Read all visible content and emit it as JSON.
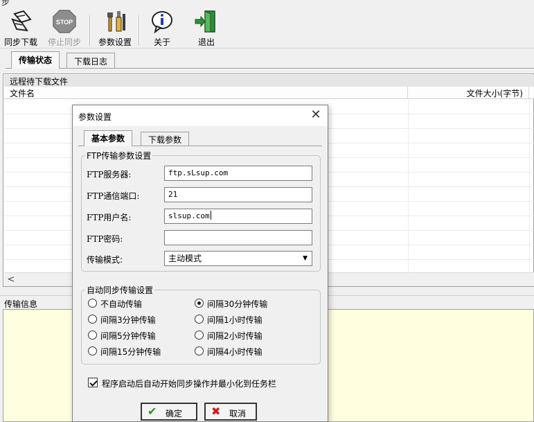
{
  "window": {
    "title_fragment": "步"
  },
  "toolbar": {
    "buttons": [
      {
        "label": "同步下载",
        "icon": "sync-download-icon",
        "enabled": true
      },
      {
        "label": "停止同步",
        "icon": "stop-icon",
        "enabled": false
      },
      {
        "label": "参数设置",
        "icon": "tools-icon",
        "enabled": true
      },
      {
        "label": "关于",
        "icon": "info-icon",
        "enabled": true
      },
      {
        "label": "退出",
        "icon": "exit-door-icon",
        "enabled": true
      }
    ],
    "stop_icon_text": "STOP"
  },
  "main_tabs": [
    {
      "label": "传输状态",
      "active": true
    },
    {
      "label": "下载日志",
      "active": false
    }
  ],
  "file_list": {
    "group_title": "远程待下载文件",
    "columns": [
      "文件名",
      "文件大小(字节)"
    ],
    "scroll_left": "<"
  },
  "info_panel": {
    "label": "传输信息",
    "background": "#ffffe0"
  },
  "dialog": {
    "title": "参数设置",
    "close": "✕",
    "tabs": [
      {
        "label": "基本参数",
        "active": true
      },
      {
        "label": "下载参数",
        "active": false
      }
    ],
    "ftp_group": {
      "title": "FTP传输参数设置",
      "fields": [
        {
          "label": "FTP服务器:",
          "value": "ftp.sLsup.com"
        },
        {
          "label": "FTP通信端口:",
          "value": "21"
        },
        {
          "label": "FTP用户名:",
          "value": "slsup.com"
        },
        {
          "label": "FTP密码:",
          "value": ""
        }
      ],
      "mode_label": "传输模式:",
      "mode_value": "主动模式",
      "mode_arrow": "▼"
    },
    "sync_group": {
      "title": "自动同步传输设置",
      "options": [
        {
          "label": "不自动传输",
          "selected": false
        },
        {
          "label": "间隔30分钟传输",
          "selected": true
        },
        {
          "label": "间隔3分钟传输",
          "selected": false
        },
        {
          "label": "间隔1小时传输",
          "selected": false
        },
        {
          "label": "间隔5分钟传输",
          "selected": false
        },
        {
          "label": "间隔2小时传输",
          "selected": false
        },
        {
          "label": "间隔15分钟传输",
          "selected": false
        },
        {
          "label": "间隔4小时传输",
          "selected": false
        }
      ]
    },
    "auto_minimize": {
      "label": "程序启动后自动开始同步操作并最小化到任务栏",
      "checked": true
    },
    "ok": {
      "label": "确定",
      "icon": "✔",
      "color": "#1e9a1e"
    },
    "cancel": {
      "label": "取消",
      "icon": "✖",
      "color": "#d01818"
    }
  }
}
